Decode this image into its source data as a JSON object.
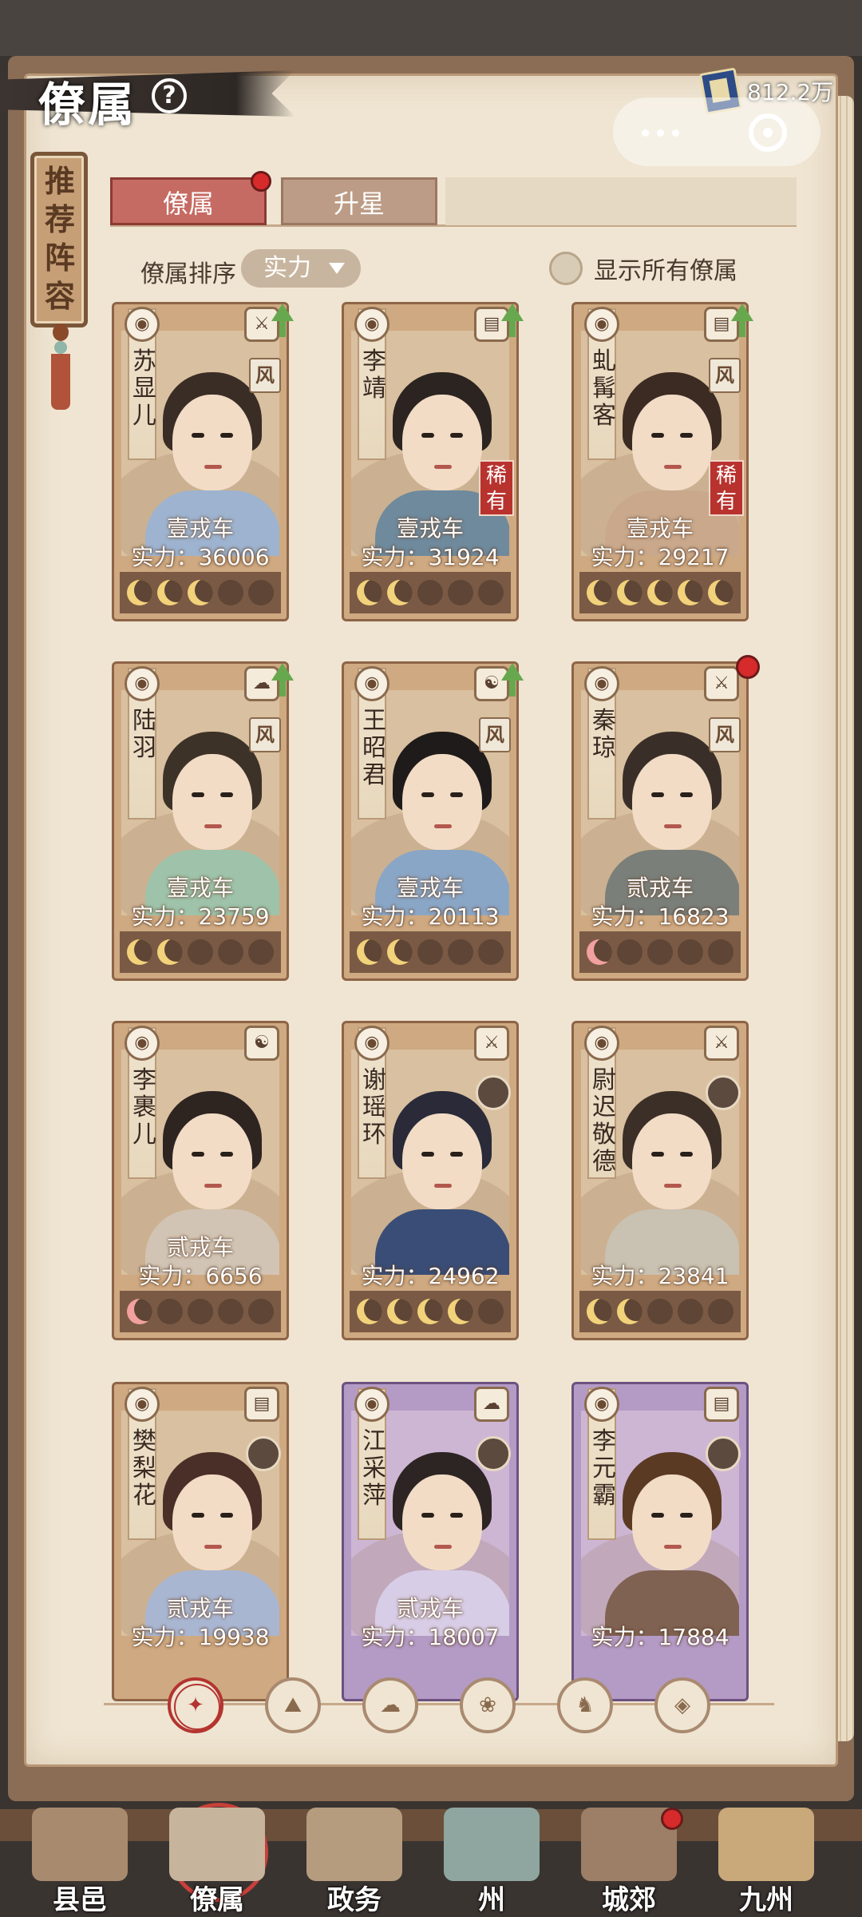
{
  "header": {
    "title": "僚属",
    "help": "?",
    "currency_value": "812.2万"
  },
  "side_plaque": {
    "label": "推荐阵容"
  },
  "tabs": [
    {
      "label": "僚属",
      "active": true,
      "has_notification": true
    },
    {
      "label": "升星",
      "active": false,
      "has_notification": false
    }
  ],
  "sort": {
    "label": "僚属排序",
    "selected": "实力",
    "show_all_label": "显示所有僚属"
  },
  "cards": [
    {
      "name": "苏显儿",
      "rank": "壹戎车",
      "power": "实力：36006",
      "moons": 3,
      "moon_color": "gold",
      "class_icon": "sword-icon",
      "upgrade": true,
      "feng": "风",
      "rare": null,
      "avatar": false,
      "notif": false,
      "purple": false
    },
    {
      "name": "李靖",
      "rank": "壹戎车",
      "power": "实力：31924",
      "moons": 2,
      "moon_color": "gold",
      "class_icon": "book-icon",
      "upgrade": true,
      "feng": null,
      "rare": "稀有",
      "avatar": false,
      "notif": false,
      "purple": false
    },
    {
      "name": "虬髯客",
      "rank": "壹戎车",
      "power": "实力：29217",
      "moons": 5,
      "moon_color": "gold",
      "class_icon": "book-icon",
      "upgrade": true,
      "feng": "风",
      "rare": "稀有",
      "avatar": false,
      "notif": false,
      "purple": false
    },
    {
      "name": "陆羽",
      "rank": "壹戎车",
      "power": "实力：23759",
      "moons": 2,
      "moon_color": "gold",
      "class_icon": "cloud-icon",
      "upgrade": true,
      "feng": "风",
      "rare": null,
      "avatar": false,
      "notif": false,
      "purple": false
    },
    {
      "name": "王昭君",
      "rank": "壹戎车",
      "power": "实力：20113",
      "moons": 2,
      "moon_color": "gold",
      "class_icon": "yin-yang-icon",
      "upgrade": true,
      "feng": "风",
      "rare": null,
      "avatar": false,
      "notif": false,
      "purple": false
    },
    {
      "name": "秦琼",
      "rank": "贰戎车",
      "power": "实力：16823",
      "moons": 1,
      "moon_color": "pink",
      "class_icon": "sword-icon",
      "upgrade": false,
      "feng": "风",
      "rare": null,
      "avatar": false,
      "notif": true,
      "purple": false
    },
    {
      "name": "李裹儿",
      "rank": "贰戎车",
      "power": "实力：6656",
      "moons": 1,
      "moon_color": "pink",
      "class_icon": "yin-yang-icon",
      "upgrade": false,
      "feng": null,
      "rare": null,
      "avatar": false,
      "notif": false,
      "purple": false
    },
    {
      "name": "谢瑶环",
      "rank": "",
      "power": "实力：24962",
      "moons": 4,
      "moon_color": "gold",
      "class_icon": "sword-icon",
      "upgrade": false,
      "feng": null,
      "rare": null,
      "avatar": true,
      "notif": false,
      "purple": false
    },
    {
      "name": "尉迟敬德",
      "rank": "",
      "power": "实力：23841",
      "moons": 2,
      "moon_color": "gold",
      "class_icon": "sword-icon",
      "upgrade": false,
      "feng": null,
      "rare": null,
      "avatar": true,
      "notif": false,
      "purple": false
    },
    {
      "name": "樊梨花",
      "rank": "贰戎车",
      "power": "实力：19938",
      "moons": 0,
      "moon_color": "gold",
      "class_icon": "book-icon",
      "upgrade": false,
      "feng": null,
      "rare": null,
      "avatar": true,
      "notif": false,
      "purple": false
    },
    {
      "name": "江采萍",
      "rank": "贰戎车",
      "power": "实力：18007",
      "moons": 0,
      "moon_color": "gold",
      "class_icon": "cloud-icon",
      "upgrade": false,
      "feng": null,
      "rare": null,
      "avatar": true,
      "notif": false,
      "purple": true
    },
    {
      "name": "李元霸",
      "rank": "",
      "power": "实力：17884",
      "moons": 0,
      "moon_color": "gold",
      "class_icon": "book-icon",
      "upgrade": false,
      "feng": null,
      "rare": null,
      "avatar": true,
      "notif": false,
      "purple": true
    }
  ],
  "filters": [
    {
      "icon": "all-icon",
      "glyph": "✦",
      "active": true
    },
    {
      "icon": "faction-mountain-icon",
      "glyph": "⛰",
      "active": false
    },
    {
      "icon": "faction-cat-icon",
      "glyph": "☁",
      "active": false
    },
    {
      "icon": "faction-fan-icon",
      "glyph": "❀",
      "active": false
    },
    {
      "icon": "faction-beast-icon",
      "glyph": "♞",
      "active": false
    },
    {
      "icon": "faction-shield-icon",
      "glyph": "◈",
      "active": false
    }
  ],
  "bottom_nav": [
    {
      "label": "县邑",
      "active": false,
      "notif": false
    },
    {
      "label": "僚属",
      "active": true,
      "notif": false
    },
    {
      "label": "政务",
      "active": false,
      "notif": false
    },
    {
      "label": "州",
      "active": false,
      "notif": false
    },
    {
      "label": "城郊",
      "active": false,
      "notif": true
    },
    {
      "label": "九州",
      "active": false,
      "notif": false
    }
  ],
  "colors": {
    "accent_red": "#c56b63",
    "parchment": "#efe5d2",
    "frame_brown": "#cfa981",
    "frame_purple": "#b49bc6",
    "upgrade_green": "#67a84f",
    "moon_gold": "#f2d27a"
  }
}
